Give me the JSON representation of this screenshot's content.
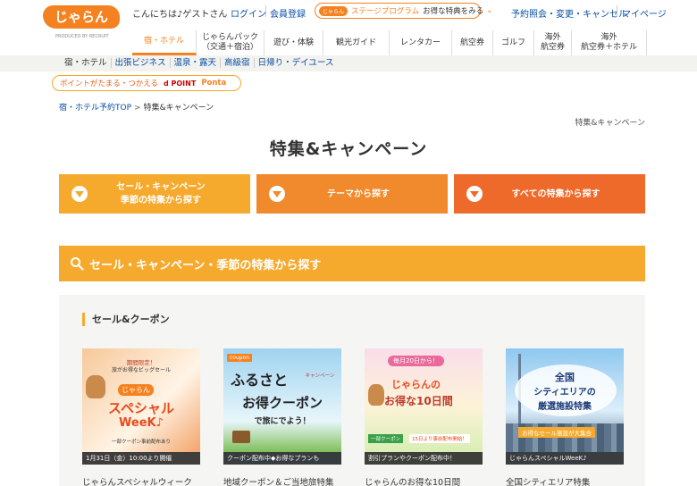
{
  "header": {
    "logo_text": "じゃらん",
    "logo_sub": "PRODUCED BY RECRUIT",
    "greeting": "こんにちは♪ゲストさん",
    "login": "ログイン",
    "register": "会員登録",
    "stage_logo": "じゃらん",
    "stage_program": "ステージプログラム",
    "stage_cta": "お得な特典をみる",
    "reservations": "予約照会・変更・キャンセル",
    "mypage": "マイページ"
  },
  "nav": {
    "items": [
      {
        "label": "宿・ホテル"
      },
      {
        "label": "じゃらんパック\n（交通＋宿泊）"
      },
      {
        "label": "遊び・体験"
      },
      {
        "label": "観光ガイド"
      },
      {
        "label": "レンタカー"
      },
      {
        "label": "航空券"
      },
      {
        "label": "ゴルフ"
      },
      {
        "label": "海外\n航空券"
      },
      {
        "label": "海外\n航空券＋ホテル"
      }
    ],
    "sub": [
      "宿・ホテル",
      "出張ビジネス",
      "温泉・露天",
      "高級宿",
      "日帰り・デイユース"
    ]
  },
  "points": {
    "text": "ポイントがたまる・つかえる",
    "dpoint": "d POINT",
    "ponta": "Ponta"
  },
  "breadcrumb": {
    "home": "宿・ホテル予約TOP",
    "sep": ">",
    "current": "特集&キャンペーン"
  },
  "right_label": "特集&キャンペーン",
  "page_title": "特集&キャンペーン",
  "categories": [
    {
      "label": "セール・キャンペーン\n季節の特集から探す",
      "color": "#f5aa2e"
    },
    {
      "label": "テーマから探す",
      "color": "#f08a2c"
    },
    {
      "label": "すべての特集から探す",
      "color": "#ee6a2b"
    }
  ],
  "section_title": "セール・キャンペーン・季節の特集から探す",
  "subsection_title": "セール&クーポン",
  "cards": [
    {
      "caption": "じゃらんスペシャルウィーク",
      "line1": "期間限定！",
      "line2": "旅がお得なビッグセール",
      "line3": "じゃらん",
      "line4": "スペシャル",
      "line5": "WeeK♪",
      "line6": "一部クーポン事前配布あり",
      "strip": "1月31日（金）10:00より開催"
    },
    {
      "caption": "地域クーポン＆ご当地旅特集",
      "badge": "coupon",
      "line1": "ふるさと",
      "line2": "キャンペーン",
      "line3": "お得クーポン",
      "line4": "で旅にでよう！",
      "strip": "クーポン配布中◆お得なプランも"
    },
    {
      "caption": "じゃらんのお得な10日間",
      "line1": "毎月20日から！",
      "line2": "じゃらんの",
      "line3": "お得な10日間",
      "line4": "一部クーポン",
      "line5": "15日より事前配布開始！",
      "strip": "割引プランやクーポン配布中！"
    },
    {
      "caption": "全国シティエリア特集",
      "line1": "全国",
      "line2": "シティエリアの",
      "line3": "厳選施設特集",
      "line4": "お得なセール施設が大集合",
      "strip": "じゃらんスペシャルWeeK♪"
    }
  ]
}
